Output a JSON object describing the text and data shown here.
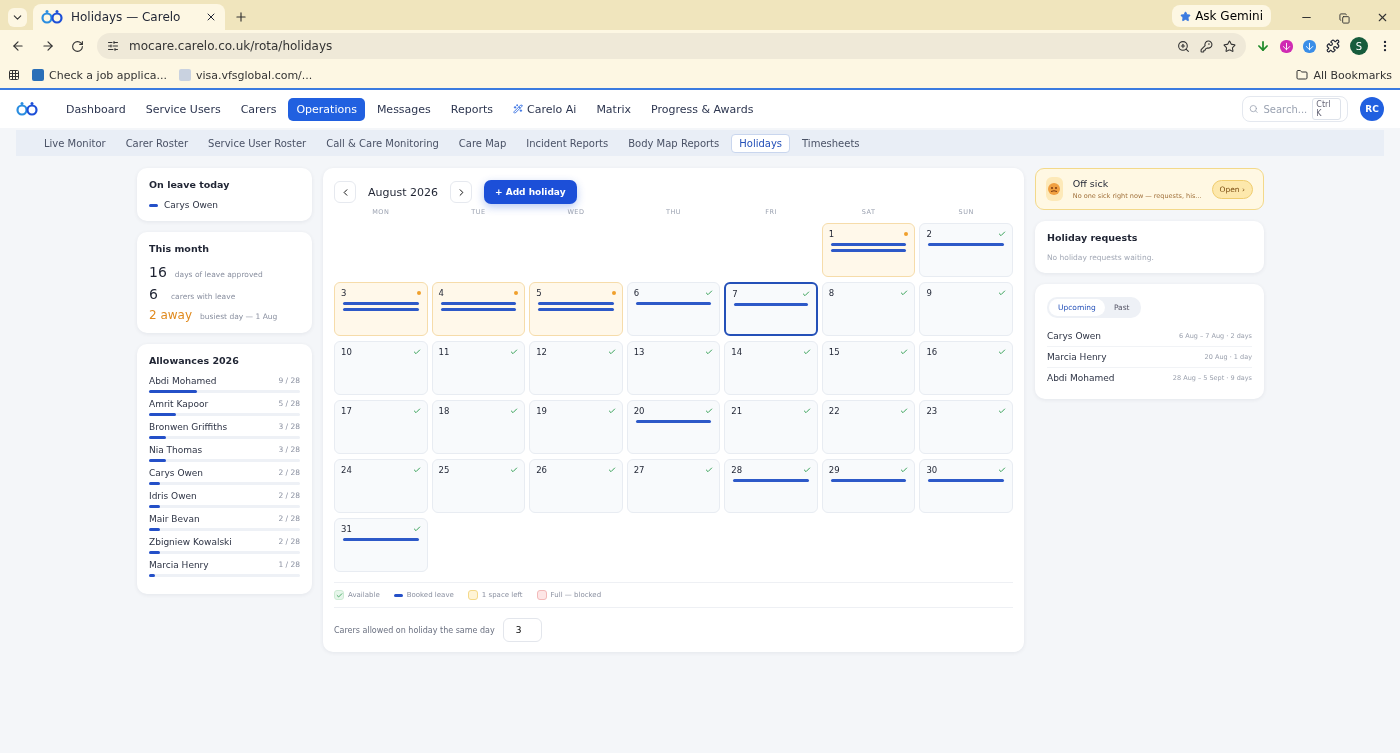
{
  "browser": {
    "tab_title": "Holidays — Carelo",
    "url": "mocare.carelo.co.uk/rota/holidays",
    "gemini": "Ask Gemini",
    "profile": "S",
    "bookmarks": [
      "Check a job applica...",
      "visa.vfsglobal.com/..."
    ],
    "all_bookmarks": "All Bookmarks"
  },
  "nav": {
    "items": [
      {
        "label": "Dashboard",
        "selected": false
      },
      {
        "label": "Service Users",
        "selected": false
      },
      {
        "label": "Carers",
        "selected": false
      },
      {
        "label": "Operations",
        "selected": true
      },
      {
        "label": "Messages",
        "selected": false
      },
      {
        "label": "Reports",
        "selected": false
      },
      {
        "label": "Carelo Ai",
        "selected": false,
        "kind": "ai"
      },
      {
        "label": "Matrix",
        "selected": false
      },
      {
        "label": "Progress & Awards",
        "selected": false
      }
    ],
    "search_placeholder": "Search...",
    "shortcut": "Ctrl K",
    "avatar": "RC"
  },
  "subnav": [
    {
      "label": "Live Monitor",
      "selected": false
    },
    {
      "label": "Carer Roster",
      "selected": false
    },
    {
      "label": "Service User Roster",
      "selected": false
    },
    {
      "label": "Call & Care Monitoring",
      "selected": false
    },
    {
      "label": "Care Map",
      "selected": false
    },
    {
      "label": "Incident Reports",
      "selected": false
    },
    {
      "label": "Body Map Reports",
      "selected": false
    },
    {
      "label": "Holidays",
      "selected": true
    },
    {
      "label": "Timesheets",
      "selected": false
    }
  ],
  "on_leave": {
    "title": "On leave today",
    "people": [
      "Carys Owen"
    ]
  },
  "this_month": {
    "title": "This month",
    "stats": [
      {
        "value": "16",
        "label": "days of leave approved",
        "kind": "plain"
      },
      {
        "value": "6",
        "label": "carers with leave",
        "kind": "plain"
      },
      {
        "value": "2 away",
        "label": "busiest day — 1 Aug",
        "kind": "warn"
      }
    ]
  },
  "allowances": {
    "title": "Allowances 2026",
    "rows": [
      {
        "name": "Abdi Mohamed",
        "count": "9 / 28",
        "level": 0.32
      },
      {
        "name": "Amrit Kapoor",
        "count": "5 / 28",
        "level": 0.18
      },
      {
        "name": "Bronwen Griffiths",
        "count": "3 / 28",
        "level": 0.11
      },
      {
        "name": "Nia Thomas",
        "count": "3 / 28",
        "level": 0.11
      },
      {
        "name": "Carys Owen",
        "count": "2 / 28",
        "level": 0.07
      },
      {
        "name": "Idris Owen",
        "count": "2 / 28",
        "level": 0.07
      },
      {
        "name": "Mair Bevan",
        "count": "2 / 28",
        "level": 0.07
      },
      {
        "name": "Zbigniew Kowalski",
        "count": "2 / 28",
        "level": 0.07
      },
      {
        "name": "Marcia Henry",
        "count": "1 / 28",
        "level": 0.04
      }
    ]
  },
  "calendar": {
    "month": "August 2026",
    "add_button": "+ Add holiday",
    "weekdays": [
      "MON",
      "TUE",
      "WED",
      "THU",
      "FRI",
      "SAT",
      "SUN"
    ],
    "days": [
      {
        "kind": "empty"
      },
      {
        "kind": "empty"
      },
      {
        "kind": "empty"
      },
      {
        "kind": "empty"
      },
      {
        "kind": "empty"
      },
      {
        "kind": "one_left",
        "day": "1",
        "selected": false,
        "leave": [
          {
            "kind": "booked"
          },
          {
            "kind": "booked"
          }
        ]
      },
      {
        "kind": "available",
        "day": "2",
        "selected": false,
        "leave": [
          {
            "kind": "booked"
          }
        ]
      },
      {
        "kind": "one_left",
        "day": "3",
        "selected": false,
        "leave": [
          {
            "kind": "booked"
          },
          {
            "kind": "booked"
          }
        ]
      },
      {
        "kind": "one_left",
        "day": "4",
        "selected": false,
        "leave": [
          {
            "kind": "booked"
          },
          {
            "kind": "booked"
          }
        ]
      },
      {
        "kind": "one_left",
        "day": "5",
        "selected": false,
        "leave": [
          {
            "kind": "booked"
          },
          {
            "kind": "booked"
          }
        ]
      },
      {
        "kind": "available",
        "day": "6",
        "selected": false,
        "leave": [
          {
            "kind": "booked"
          }
        ]
      },
      {
        "kind": "available",
        "day": "7",
        "selected": true,
        "leave": [
          {
            "kind": "booked"
          }
        ]
      },
      {
        "kind": "available",
        "day": "8",
        "selected": false
      },
      {
        "kind": "available",
        "day": "9",
        "selected": false
      },
      {
        "kind": "available",
        "day": "10",
        "selected": false
      },
      {
        "kind": "available",
        "day": "11",
        "selected": false
      },
      {
        "kind": "available",
        "day": "12",
        "selected": false
      },
      {
        "kind": "available",
        "day": "13",
        "selected": false
      },
      {
        "kind": "available",
        "day": "14",
        "selected": false
      },
      {
        "kind": "available",
        "day": "15",
        "selected": false
      },
      {
        "kind": "available",
        "day": "16",
        "selected": false
      },
      {
        "kind": "available",
        "day": "17",
        "selected": false
      },
      {
        "kind": "available",
        "day": "18",
        "selected": false
      },
      {
        "kind": "available",
        "day": "19",
        "selected": false
      },
      {
        "kind": "available",
        "day": "20",
        "selected": false,
        "leave": [
          {
            "kind": "booked"
          }
        ]
      },
      {
        "kind": "available",
        "day": "21",
        "selected": false
      },
      {
        "kind": "available",
        "day": "22",
        "selected": false
      },
      {
        "kind": "available",
        "day": "23",
        "selected": false
      },
      {
        "kind": "available",
        "day": "24",
        "selected": false
      },
      {
        "kind": "available",
        "day": "25",
        "selected": false
      },
      {
        "kind": "available",
        "day": "26",
        "selected": false
      },
      {
        "kind": "available",
        "day": "27",
        "selected": false
      },
      {
        "kind": "available",
        "day": "28",
        "selected": false,
        "leave": [
          {
            "kind": "booked"
          }
        ]
      },
      {
        "kind": "available",
        "day": "29",
        "selected": false,
        "leave": [
          {
            "kind": "booked"
          }
        ]
      },
      {
        "kind": "available",
        "day": "30",
        "selected": false,
        "leave": [
          {
            "kind": "booked"
          }
        ]
      },
      {
        "kind": "available",
        "day": "31",
        "selected": false,
        "leave": [
          {
            "kind": "booked"
          }
        ]
      }
    ],
    "legend": [
      {
        "kind": "available",
        "label": "Available"
      },
      {
        "kind": "booked",
        "label": "Booked leave"
      },
      {
        "kind": "one_left",
        "label": "1 space left"
      },
      {
        "kind": "full",
        "label": "Full — blocked"
      }
    ],
    "limit_label": "Carers allowed on holiday the same day",
    "limit_value": "3"
  },
  "off_sick": {
    "title": "Off sick",
    "text": "No one sick right now — requests, his...",
    "button": "Open ›"
  },
  "requests": {
    "title": "Holiday requests",
    "empty": "No holiday requests waiting."
  },
  "upcoming": {
    "tabs": [
      {
        "label": "Upcoming",
        "selected": true
      },
      {
        "label": "Past",
        "selected": false
      }
    ],
    "rows": [
      {
        "name": "Carys Owen",
        "dates": "6 Aug – 7 Aug · 2 days"
      },
      {
        "name": "Marcia Henry",
        "dates": "20 Aug · 1 day"
      },
      {
        "name": "Abdi Mohamed",
        "dates": "28 Aug – 5 Sept · 9 days"
      }
    ]
  }
}
